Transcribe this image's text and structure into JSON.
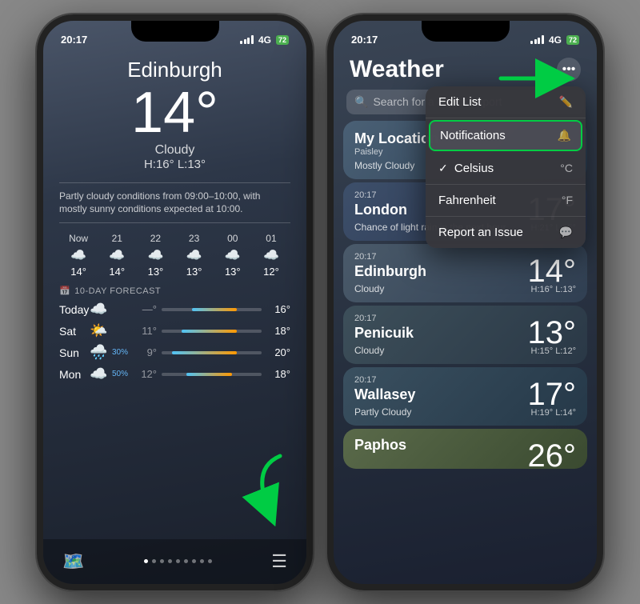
{
  "leftPhone": {
    "statusBar": {
      "time": "20:17",
      "signal": "4G",
      "battery": "72"
    },
    "city": "Edinburgh",
    "temperature": "14°",
    "condition": "Cloudy",
    "hiLo": "H:16° L:13°",
    "forecastText": "Partly cloudy conditions from 09:00–10:00, with mostly sunny conditions expected at 10:00.",
    "hourly": [
      {
        "label": "Now",
        "icon": "☁️",
        "temp": "14°"
      },
      {
        "label": "21",
        "icon": "☁️",
        "temp": "14°"
      },
      {
        "label": "22",
        "icon": "☁️",
        "temp": "13°"
      },
      {
        "label": "23",
        "icon": "☁️",
        "temp": "13°"
      },
      {
        "label": "00",
        "icon": "☁️",
        "temp": "13°"
      },
      {
        "label": "01",
        "icon": "☁️",
        "temp": "12°"
      }
    ],
    "tenDayLabel": "10-DAY FORECAST",
    "forecast": [
      {
        "day": "Today",
        "icon": "☁️",
        "pct": "",
        "low": "—°",
        "high": "16°",
        "barLeft": "30%",
        "barWidth": "50%"
      },
      {
        "day": "Sat",
        "icon": "🌤️",
        "pct": "",
        "low": "11°",
        "high": "18°",
        "barLeft": "20%",
        "barWidth": "55%"
      },
      {
        "day": "Sun",
        "icon": "🌧️",
        "pct": "30%",
        "low": "9°",
        "high": "20°",
        "barLeft": "15%",
        "barWidth": "60%"
      },
      {
        "day": "Mon",
        "icon": "☁️",
        "pct": "50%",
        "low": "12°",
        "high": "18°",
        "barLeft": "28%",
        "barWidth": "45%"
      }
    ]
  },
  "rightPhone": {
    "statusBar": {
      "time": "20:17",
      "signal": "4G",
      "battery": "72"
    },
    "title": "Weathe",
    "searchPlaceholder": "Search for a city or airport",
    "menu": {
      "items": [
        {
          "label": "Edit List",
          "icon": "✏️",
          "checked": false
        },
        {
          "label": "Notifications",
          "icon": "🔔",
          "checked": false,
          "highlighted": true
        },
        {
          "label": "Celsius",
          "icon": "°C",
          "checked": true
        },
        {
          "label": "Fahrenheit",
          "icon": "°F",
          "checked": false
        },
        {
          "label": "Report an Issue",
          "icon": "💬",
          "checked": false
        }
      ]
    },
    "cards": [
      {
        "id": "my-location",
        "label": "My Location",
        "sublabel": "Paisley",
        "time": "",
        "condition": "Mostly Cloudy",
        "temperature": "",
        "hiLo": ""
      },
      {
        "id": "london",
        "label": "London",
        "time": "20:17",
        "condition": "Chance of light rain in the next hour",
        "temperature": "17°",
        "hiLo": "H:21° L:15°"
      },
      {
        "id": "edinburgh",
        "label": "Edinburgh",
        "time": "20:17",
        "condition": "Cloudy",
        "temperature": "14°",
        "hiLo": "H:16° L:13°"
      },
      {
        "id": "penicuik",
        "label": "Penicuik",
        "time": "20:17",
        "condition": "Cloudy",
        "temperature": "13°",
        "hiLo": "H:15° L:12°"
      },
      {
        "id": "wallasey",
        "label": "Wallasey",
        "time": "20:17",
        "condition": "Partly Cloudy",
        "temperature": "17°",
        "hiLo": "H:19° L:14°"
      },
      {
        "id": "paphos",
        "label": "Paphos",
        "time": "",
        "condition": "",
        "temperature": "26°",
        "hiLo": ""
      }
    ]
  }
}
